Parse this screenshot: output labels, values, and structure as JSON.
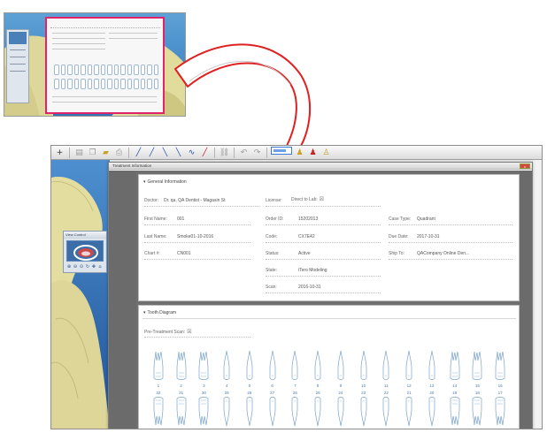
{
  "dialog": {
    "title": "Treatment Information",
    "close_label": "x"
  },
  "general": {
    "section_title": "General Information",
    "doctor_label": "Doctor:",
    "doctor_value": "Dr. qa, QA Dentist - Magasin St",
    "license_label": "License:",
    "direct_to_lab_label": "Direct to Lab:",
    "first_name_label": "First Name:",
    "first_name_value": "001",
    "last_name_label": "Last Name:",
    "last_name_value": "Smoke01-10-2016",
    "chart_label": "Chart #:",
    "chart_value": "CN001",
    "order_id_label": "Order ID:",
    "order_id_value": "15202013",
    "code_label": "Code:",
    "code_value": "CX7E42",
    "status_label": "Status:",
    "status_value": "Active",
    "state_label": "State:",
    "state_value": "iTero Modeling",
    "scan_label": "Scan:",
    "scan_value": "2016-10-31",
    "case_type_label": "Case Type:",
    "case_type_value": "Quadrant",
    "due_date_label": "Due Date:",
    "due_date_value": "2017-10-31",
    "ship_to_label": "Ship To:",
    "ship_to_value": "QACompany Online Den..."
  },
  "tooth_diagram": {
    "section_title": "Tooth Diagram",
    "pre_treatment_label": "Pre-Treatment Scan:",
    "upper_numbers": [
      "1",
      "2",
      "3",
      "4",
      "5",
      "6",
      "7",
      "8",
      "9",
      "10",
      "11",
      "12",
      "13",
      "14",
      "15",
      "16"
    ],
    "lower_numbers": [
      "32",
      "31",
      "30",
      "29",
      "28",
      "27",
      "26",
      "25",
      "24",
      "23",
      "22",
      "21",
      "20",
      "19",
      "18",
      "17"
    ]
  },
  "view_panel": {
    "title": "View Control"
  },
  "toolbar": {
    "buttons": [
      "add-icon",
      "save-icon",
      "copy-icon",
      "folder-icon",
      "print-icon",
      "pen-icon",
      "brush-icon",
      "line-icon",
      "line-alt-icon",
      "curve-icon",
      "knife-icon",
      "chain-icon",
      "undo-icon",
      "redo-icon",
      "bell-icon",
      "bell-red-icon",
      "tooth-icon"
    ]
  },
  "colors": {
    "accent_pink": "#e0246a",
    "arrow_red": "#e02020",
    "tooth_outline": "#7aa2cc",
    "sky_blue": "#3a7bc2",
    "model_yellow": "#e8e0a0"
  }
}
